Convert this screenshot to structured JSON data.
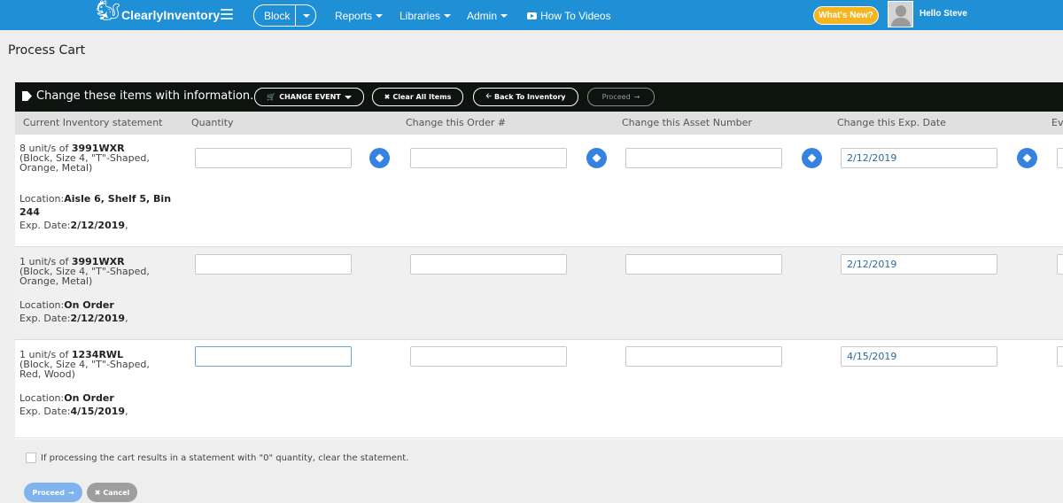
{
  "topbar": {
    "brand": "ClearlyInventory",
    "block_label": "Block",
    "nav": [
      "Reports",
      "Libraries",
      "Admin"
    ],
    "how_to": "How To Videos",
    "whats_new": "What's New?",
    "greeting": "Hello Steve"
  },
  "page": {
    "title": "Process Cart"
  },
  "panel": {
    "heading": "Change these items with information.",
    "change_event": "CHANGE EVENT",
    "clear_all": "Clear All Items",
    "back": "Back To Inventory",
    "proceed": "Proceed"
  },
  "columns": [
    "Current Inventory statement",
    "Quantity",
    "Change this Order #",
    "Change this Asset Number",
    "Change this Exp. Date",
    "Ev"
  ],
  "rows": [
    {
      "qty_prefix": "8 unit/s of ",
      "sku": "3991WXR",
      "desc1": "(Block, Size 4, \"T\"-Shaped,",
      "desc2": "Orange, Metal)",
      "loc_label": "Location:",
      "loc1": "Aisle 6, Shelf 5, Bin",
      "loc2": "244",
      "exp_label": "Exp. Date:",
      "exp": "2/12/2019",
      "exp_suffix": ",",
      "quantity": "",
      "order": "",
      "asset": "",
      "exp_input": "2/12/2019"
    },
    {
      "qty_prefix": "1 unit/s of ",
      "sku": "3991WXR",
      "desc1": "(Block, Size 4, \"T\"-Shaped,",
      "desc2": "Orange, Metal)",
      "loc_label": "Location:",
      "loc1": "On Order",
      "loc2": "",
      "exp_label": "Exp. Date:",
      "exp": "2/12/2019",
      "exp_suffix": ",",
      "quantity": "",
      "order": "",
      "asset": "",
      "exp_input": "2/12/2019"
    },
    {
      "qty_prefix": "1 unit/s of ",
      "sku": "1234RWL",
      "desc1": "(Block, Size 4, \"T\"-Shaped,",
      "desc2": "Red, Wood)",
      "loc_label": "Location:",
      "loc1": "On Order",
      "loc2": "",
      "exp_label": "Exp. Date:",
      "exp": "4/15/2019",
      "exp_suffix": ",",
      "quantity": "",
      "order": "",
      "asset": "",
      "exp_input": "4/15/2019"
    }
  ],
  "footer": {
    "checkbox_label": "If processing the cart results in a statement with \"0\" quantity, clear the statement.",
    "proceed": "Proceed",
    "cancel": "Cancel"
  },
  "colors": {
    "topbar": "#1f8fd6",
    "panel_bar": "#0d1410",
    "pin": "#3582e0",
    "whats_new": "#f6b41f",
    "proceed_btn": "#7fb3ef",
    "cancel_btn": "#9e9e9e"
  },
  "icons": [
    "squirrel-logo-icon",
    "hamburger-icon",
    "caret-down-icon",
    "youtube-icon",
    "avatar-icon",
    "tag-icon",
    "cart-icon",
    "times-icon",
    "arrow-left-icon",
    "arrow-right-icon",
    "pin-icon"
  ]
}
